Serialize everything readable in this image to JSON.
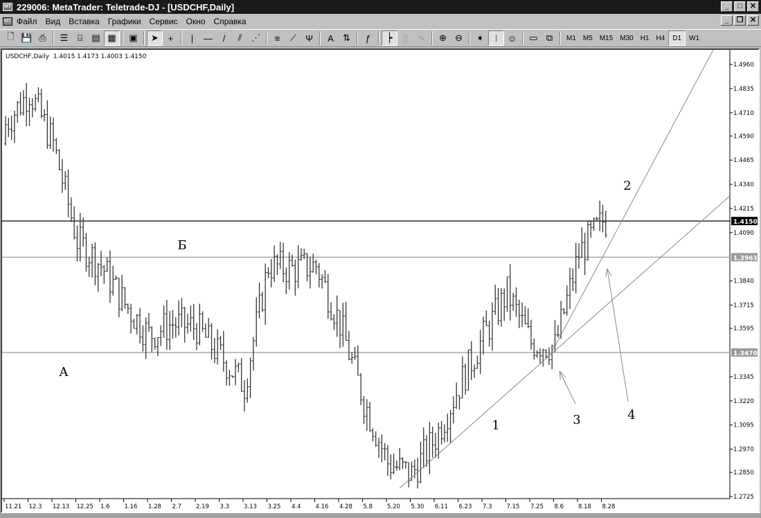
{
  "window": {
    "title": "229006: MetaTrader: Teletrade-DJ - [USDCHF,Daily]",
    "app_icon": "metatrader-icon"
  },
  "menu": [
    "Файл",
    "Вид",
    "Вставка",
    "Графики",
    "Сервис",
    "Окно",
    "Справка"
  ],
  "toolbar": {
    "icons": [
      "new-chart-icon",
      "save-icon",
      "print-icon",
      "market-watch-icon",
      "navigator-icon",
      "terminal-icon",
      "strategy-tester-icon",
      "properties-icon",
      "cursor-icon",
      "crosshair-icon",
      "vertical-line-icon",
      "horizontal-line-icon",
      "trendline-icon",
      "channel-icon",
      "gann-fan-icon",
      "fibonacci-icon",
      "fibo-fan-icon",
      "andrews-pitchfork-icon",
      "text-icon",
      "arrow-label-icon",
      "indicator-icon",
      "bar-chart-icon",
      "candlestick-icon",
      "line-chart-icon",
      "zoom-in-icon",
      "zoom-out-icon",
      "auto-scroll-icon",
      "chart-shift-icon",
      "expert-advisor-icon",
      "tile-window-icon",
      "cascade-window-icon"
    ],
    "timeframes": [
      "M1",
      "M5",
      "M15",
      "M30",
      "H1",
      "H4",
      "D1",
      "W1"
    ],
    "active_timeframe": "D1"
  },
  "chart": {
    "info": "USDCHF,Daily  1.4015 1.4173 1.4003 1.4150",
    "annotations": {
      "A": "А",
      "B": "Б",
      "n1": "1",
      "n2": "2",
      "n3": "3",
      "n4": "4"
    },
    "hlines": [
      {
        "price": 1.415,
        "label": "1.4150",
        "color": "#000000"
      },
      {
        "price": 1.3963,
        "label": "1.3963",
        "color": "#999999"
      },
      {
        "price": 1.347,
        "label": "1.3470",
        "color": "#999999"
      }
    ]
  },
  "chart_data": {
    "type": "line",
    "title": "USDCHF,Daily",
    "x": [
      "11.21",
      "12.3",
      "12.13",
      "12.25",
      "1.6",
      "1.16",
      "1.28",
      "2.7",
      "2.19",
      "3.3",
      "3.13",
      "3.25",
      "4.4",
      "4.16",
      "4.28",
      "5.8",
      "5.20",
      "5.30",
      "6.11",
      "6.23",
      "7.3",
      "7.15",
      "7.25",
      "8.6",
      "8.18",
      "8.28"
    ],
    "close": [
      1.465,
      1.482,
      1.455,
      1.405,
      1.392,
      1.372,
      1.356,
      1.362,
      1.36,
      1.345,
      1.33,
      1.392,
      1.39,
      1.392,
      1.362,
      1.322,
      1.29,
      1.284,
      1.303,
      1.33,
      1.355,
      1.378,
      1.352,
      1.35,
      1.398,
      1.415
    ],
    "y_ticks": [
      "1.4960",
      "1.4835",
      "1.4710",
      "1.4590",
      "1.4465",
      "1.4340",
      "1.4215",
      "1.4090",
      "1.3840",
      "1.3715",
      "1.3595",
      "1.3345",
      "1.3220",
      "1.3095",
      "1.2970",
      "1.2850",
      "1.2725"
    ],
    "ylim": [
      1.2725,
      1.502
    ],
    "last_price": "1.4150"
  }
}
